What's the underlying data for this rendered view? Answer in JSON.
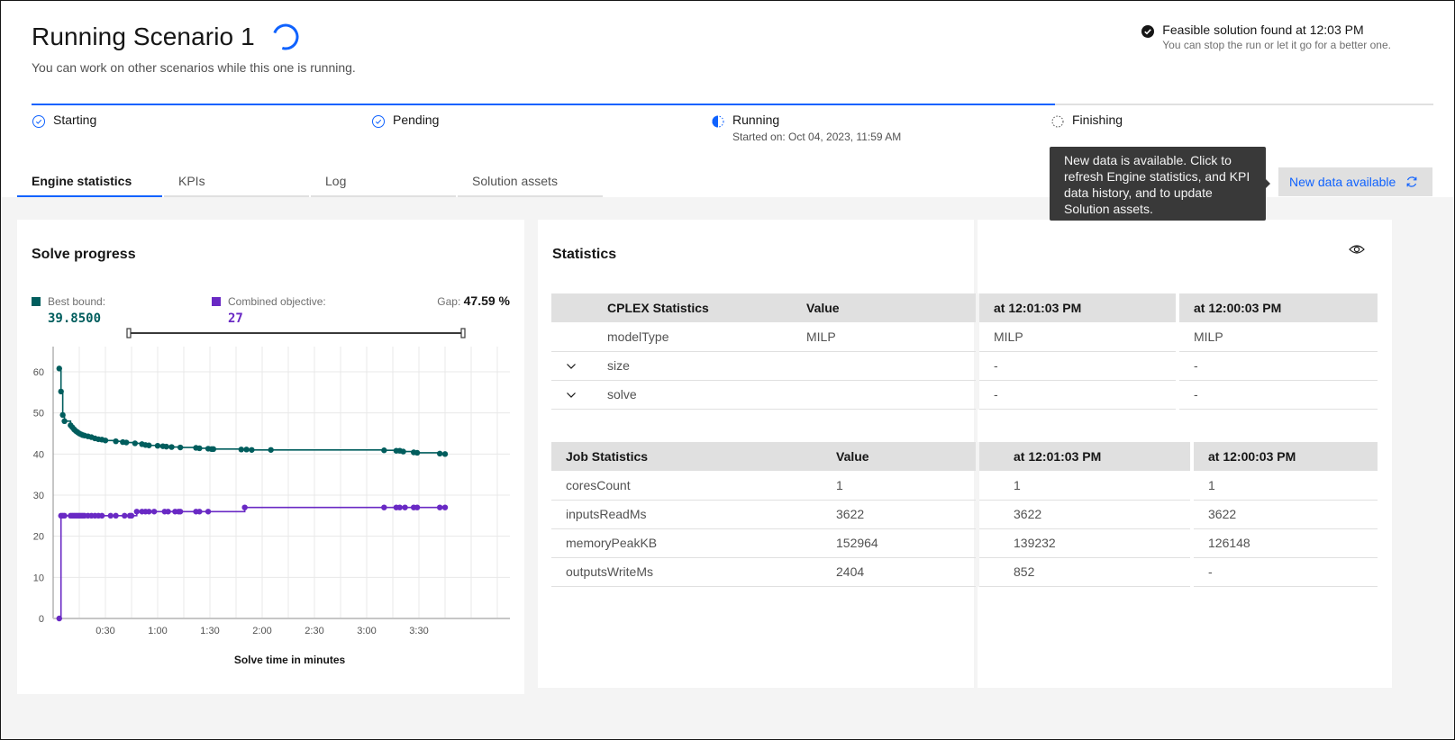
{
  "header": {
    "title": "Running Scenario 1",
    "subtitle": "You can work on other scenarios while this one is running.",
    "notice_title": "Feasible solution found at 12:03 PM",
    "notice_subtitle": "You can stop the run or let it go for a better one."
  },
  "progress": {
    "fraction_complete": 0.73,
    "steps": [
      {
        "label": "Starting",
        "status": "complete",
        "sub": ""
      },
      {
        "label": "Pending",
        "status": "complete",
        "sub": ""
      },
      {
        "label": "Running",
        "status": "in-progress",
        "sub": "Started on: Oct 04, 2023, 11:59 AM"
      },
      {
        "label": "Finishing",
        "status": "incomplete",
        "sub": ""
      }
    ]
  },
  "tabs": [
    {
      "label": "Engine statistics",
      "active": true
    },
    {
      "label": "KPIs",
      "active": false
    },
    {
      "label": "Log",
      "active": false
    },
    {
      "label": "Solution assets",
      "active": false
    }
  ],
  "tooltip": {
    "text": "New data is available. Click to refresh Engine statistics, and KPI data history, and to update Solution assets."
  },
  "new_data_button": {
    "label": "New data available",
    "icon": "refresh-icon"
  },
  "colors": {
    "accent": "#0f62fe",
    "best_bound": "#005d5d",
    "combined_objective": "#6929c4"
  },
  "solve_progress": {
    "title": "Solve progress",
    "best_bound_label": "Best bound:",
    "best_bound_value": "39.8500",
    "combined_objective_label": "Combined objective:",
    "combined_objective_value": "27",
    "gap_label": "Gap:",
    "gap_value": "47.59 %"
  },
  "chart_data": {
    "type": "line",
    "title": "Solve progress",
    "xlabel": "Solve time in minutes",
    "ylabel": "",
    "xlim_seconds": [
      0,
      262
    ],
    "ylim": [
      0,
      65
    ],
    "x_ticks": [
      {
        "t": 30,
        "label": "0:30"
      },
      {
        "t": 60,
        "label": "1:00"
      },
      {
        "t": 90,
        "label": "1:30"
      },
      {
        "t": 120,
        "label": "2:00"
      },
      {
        "t": 150,
        "label": "2:30"
      },
      {
        "t": 180,
        "label": "3:00"
      },
      {
        "t": 210,
        "label": "3:30"
      }
    ],
    "y_ticks": [
      0,
      10,
      20,
      30,
      40,
      50,
      60
    ],
    "grid": true,
    "step_line": true,
    "series": [
      {
        "name": "Best bound",
        "points": [
          [
            3.5,
            60.8
          ],
          [
            4.5,
            55.2
          ],
          [
            5.5,
            49.5
          ],
          [
            6.5,
            48
          ],
          [
            10,
            47
          ],
          [
            11,
            46.5
          ],
          [
            12,
            46
          ],
          [
            13,
            45.6
          ],
          [
            14,
            45.3
          ],
          [
            15,
            45
          ],
          [
            16,
            44.8
          ],
          [
            17,
            44.6
          ],
          [
            18,
            44.5
          ],
          [
            20,
            44.3
          ],
          [
            22,
            44.1
          ],
          [
            24,
            43.8
          ],
          [
            26,
            43.6
          ],
          [
            28,
            43.5
          ],
          [
            30,
            43.3
          ],
          [
            36,
            43.1
          ],
          [
            40,
            42.9
          ],
          [
            42,
            42.8
          ],
          [
            47,
            42.6
          ],
          [
            51,
            42.4
          ],
          [
            53,
            42.2
          ],
          [
            55,
            42.1
          ],
          [
            60,
            42
          ],
          [
            63,
            41.9
          ],
          [
            65,
            41.8
          ],
          [
            68,
            41.7
          ],
          [
            73,
            41.6
          ],
          [
            82,
            41.5
          ],
          [
            84,
            41.4
          ],
          [
            89,
            41.3
          ],
          [
            91,
            41.2
          ],
          [
            92,
            41.2
          ],
          [
            108,
            41.1
          ],
          [
            111,
            41.1
          ],
          [
            114,
            41
          ],
          [
            125,
            41
          ],
          [
            190,
            40.9
          ],
          [
            197,
            40.8
          ],
          [
            199,
            40.8
          ],
          [
            201,
            40.6
          ],
          [
            207,
            40.4
          ],
          [
            209,
            40.3
          ],
          [
            222,
            40.1
          ],
          [
            225,
            40
          ]
        ]
      },
      {
        "name": "Combined objective",
        "points": [
          [
            3.5,
            0
          ],
          [
            4.5,
            25
          ],
          [
            5.5,
            25
          ],
          [
            6.5,
            25
          ],
          [
            10,
            25
          ],
          [
            11,
            25
          ],
          [
            12,
            25
          ],
          [
            13,
            25
          ],
          [
            14,
            25
          ],
          [
            15,
            25
          ],
          [
            16,
            25
          ],
          [
            17,
            25
          ],
          [
            18,
            25
          ],
          [
            20,
            25
          ],
          [
            22,
            25
          ],
          [
            24,
            25
          ],
          [
            26,
            25
          ],
          [
            28,
            25
          ],
          [
            33,
            25
          ],
          [
            36,
            25
          ],
          [
            41,
            25
          ],
          [
            44,
            25
          ],
          [
            45,
            25
          ],
          [
            48,
            26
          ],
          [
            51,
            26
          ],
          [
            53,
            26
          ],
          [
            55,
            26
          ],
          [
            58,
            26
          ],
          [
            64,
            26
          ],
          [
            66,
            26
          ],
          [
            70,
            26
          ],
          [
            72,
            26
          ],
          [
            73,
            26
          ],
          [
            82,
            26
          ],
          [
            84,
            26
          ],
          [
            89,
            26
          ],
          [
            110,
            27
          ],
          [
            190,
            27
          ],
          [
            197,
            27
          ],
          [
            199,
            27
          ],
          [
            202,
            27
          ],
          [
            207,
            27
          ],
          [
            209,
            27
          ],
          [
            222,
            27
          ],
          [
            225,
            27
          ]
        ]
      }
    ]
  },
  "statistics": {
    "title": "Statistics",
    "cplex": {
      "headers": [
        "CPLEX Statistics",
        "Value",
        "at 12:01:03 PM",
        "at 12:00:03 PM"
      ],
      "rows": [
        {
          "expandable": false,
          "name": "modelType",
          "value": "MILP",
          "h1": "MILP",
          "h2": "MILP"
        },
        {
          "expandable": true,
          "name": "size",
          "value": "",
          "h1": "-",
          "h2": "-"
        },
        {
          "expandable": true,
          "name": "solve",
          "value": "",
          "h1": "-",
          "h2": "-"
        }
      ]
    },
    "job": {
      "headers": [
        "Job Statistics",
        "Value",
        "at 12:01:03 PM",
        "at 12:00:03 PM"
      ],
      "rows": [
        {
          "name": "coresCount",
          "value": "1",
          "h1": "1",
          "h2": "1"
        },
        {
          "name": "inputsReadMs",
          "value": "3622",
          "h1": "3622",
          "h2": "3622"
        },
        {
          "name": "memoryPeakKB",
          "value": "152964",
          "h1": "139232",
          "h2": "126148"
        },
        {
          "name": "outputsWriteMs",
          "value": "2404",
          "h1": "852",
          "h2": "-"
        }
      ]
    }
  }
}
